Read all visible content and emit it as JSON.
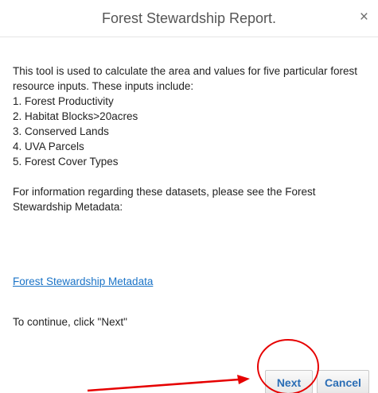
{
  "dialog": {
    "title": "Forest Stewardship Report.",
    "close_symbol": "×",
    "intro": "This tool is used to calculate the area and values for five particular forest resource inputs. These inputs include:",
    "inputs": [
      "1. Forest Productivity",
      "2. Habitat Blocks>20acres",
      "3. Conserved Lands",
      "4. UVA Parcels",
      "5. Forest Cover Types"
    ],
    "info": "For information regarding these datasets, please see the Forest Stewardship Metadata:",
    "link_text": "Forest Stewardship Metadata",
    "continue_text": "To continue, click \"Next\"",
    "next_label": "Next",
    "cancel_label": "Cancel"
  },
  "colors": {
    "link": "#1a73c7",
    "button_text": "#2a6db5",
    "annotation": "#e60000"
  },
  "icons": {
    "close": "close-icon"
  }
}
